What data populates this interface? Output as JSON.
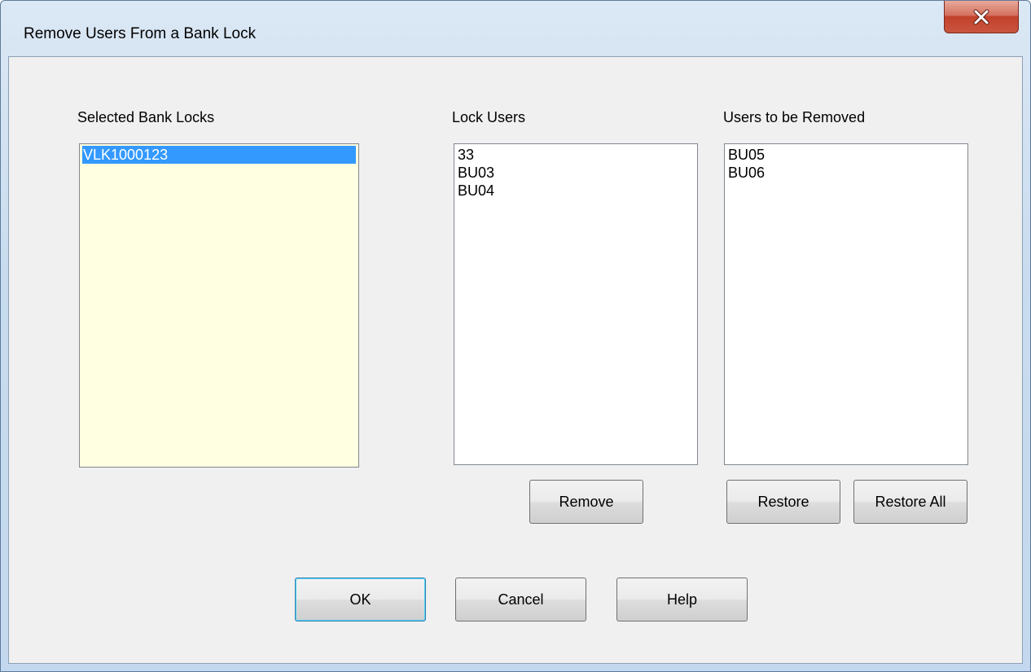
{
  "window": {
    "title": "Remove Users From a Bank Lock",
    "close_icon": "close-x-icon"
  },
  "selected_bank_locks": {
    "label": "Selected Bank Locks",
    "items": [
      "VLK1000123"
    ]
  },
  "lock_users": {
    "label": "Lock Users",
    "items": [
      "33",
      "BU03",
      "BU04"
    ]
  },
  "users_to_be_removed": {
    "label": "Users to be Removed",
    "items": [
      "BU05",
      "BU06"
    ]
  },
  "buttons": {
    "remove": "Remove",
    "restore": "Restore",
    "restore_all": "Restore All",
    "ok": "OK",
    "cancel": "Cancel",
    "help": "Help"
  },
  "colors": {
    "selection": "#3399ff",
    "bank_list_background": "#ffffe1",
    "close_button": "#c2412b"
  }
}
